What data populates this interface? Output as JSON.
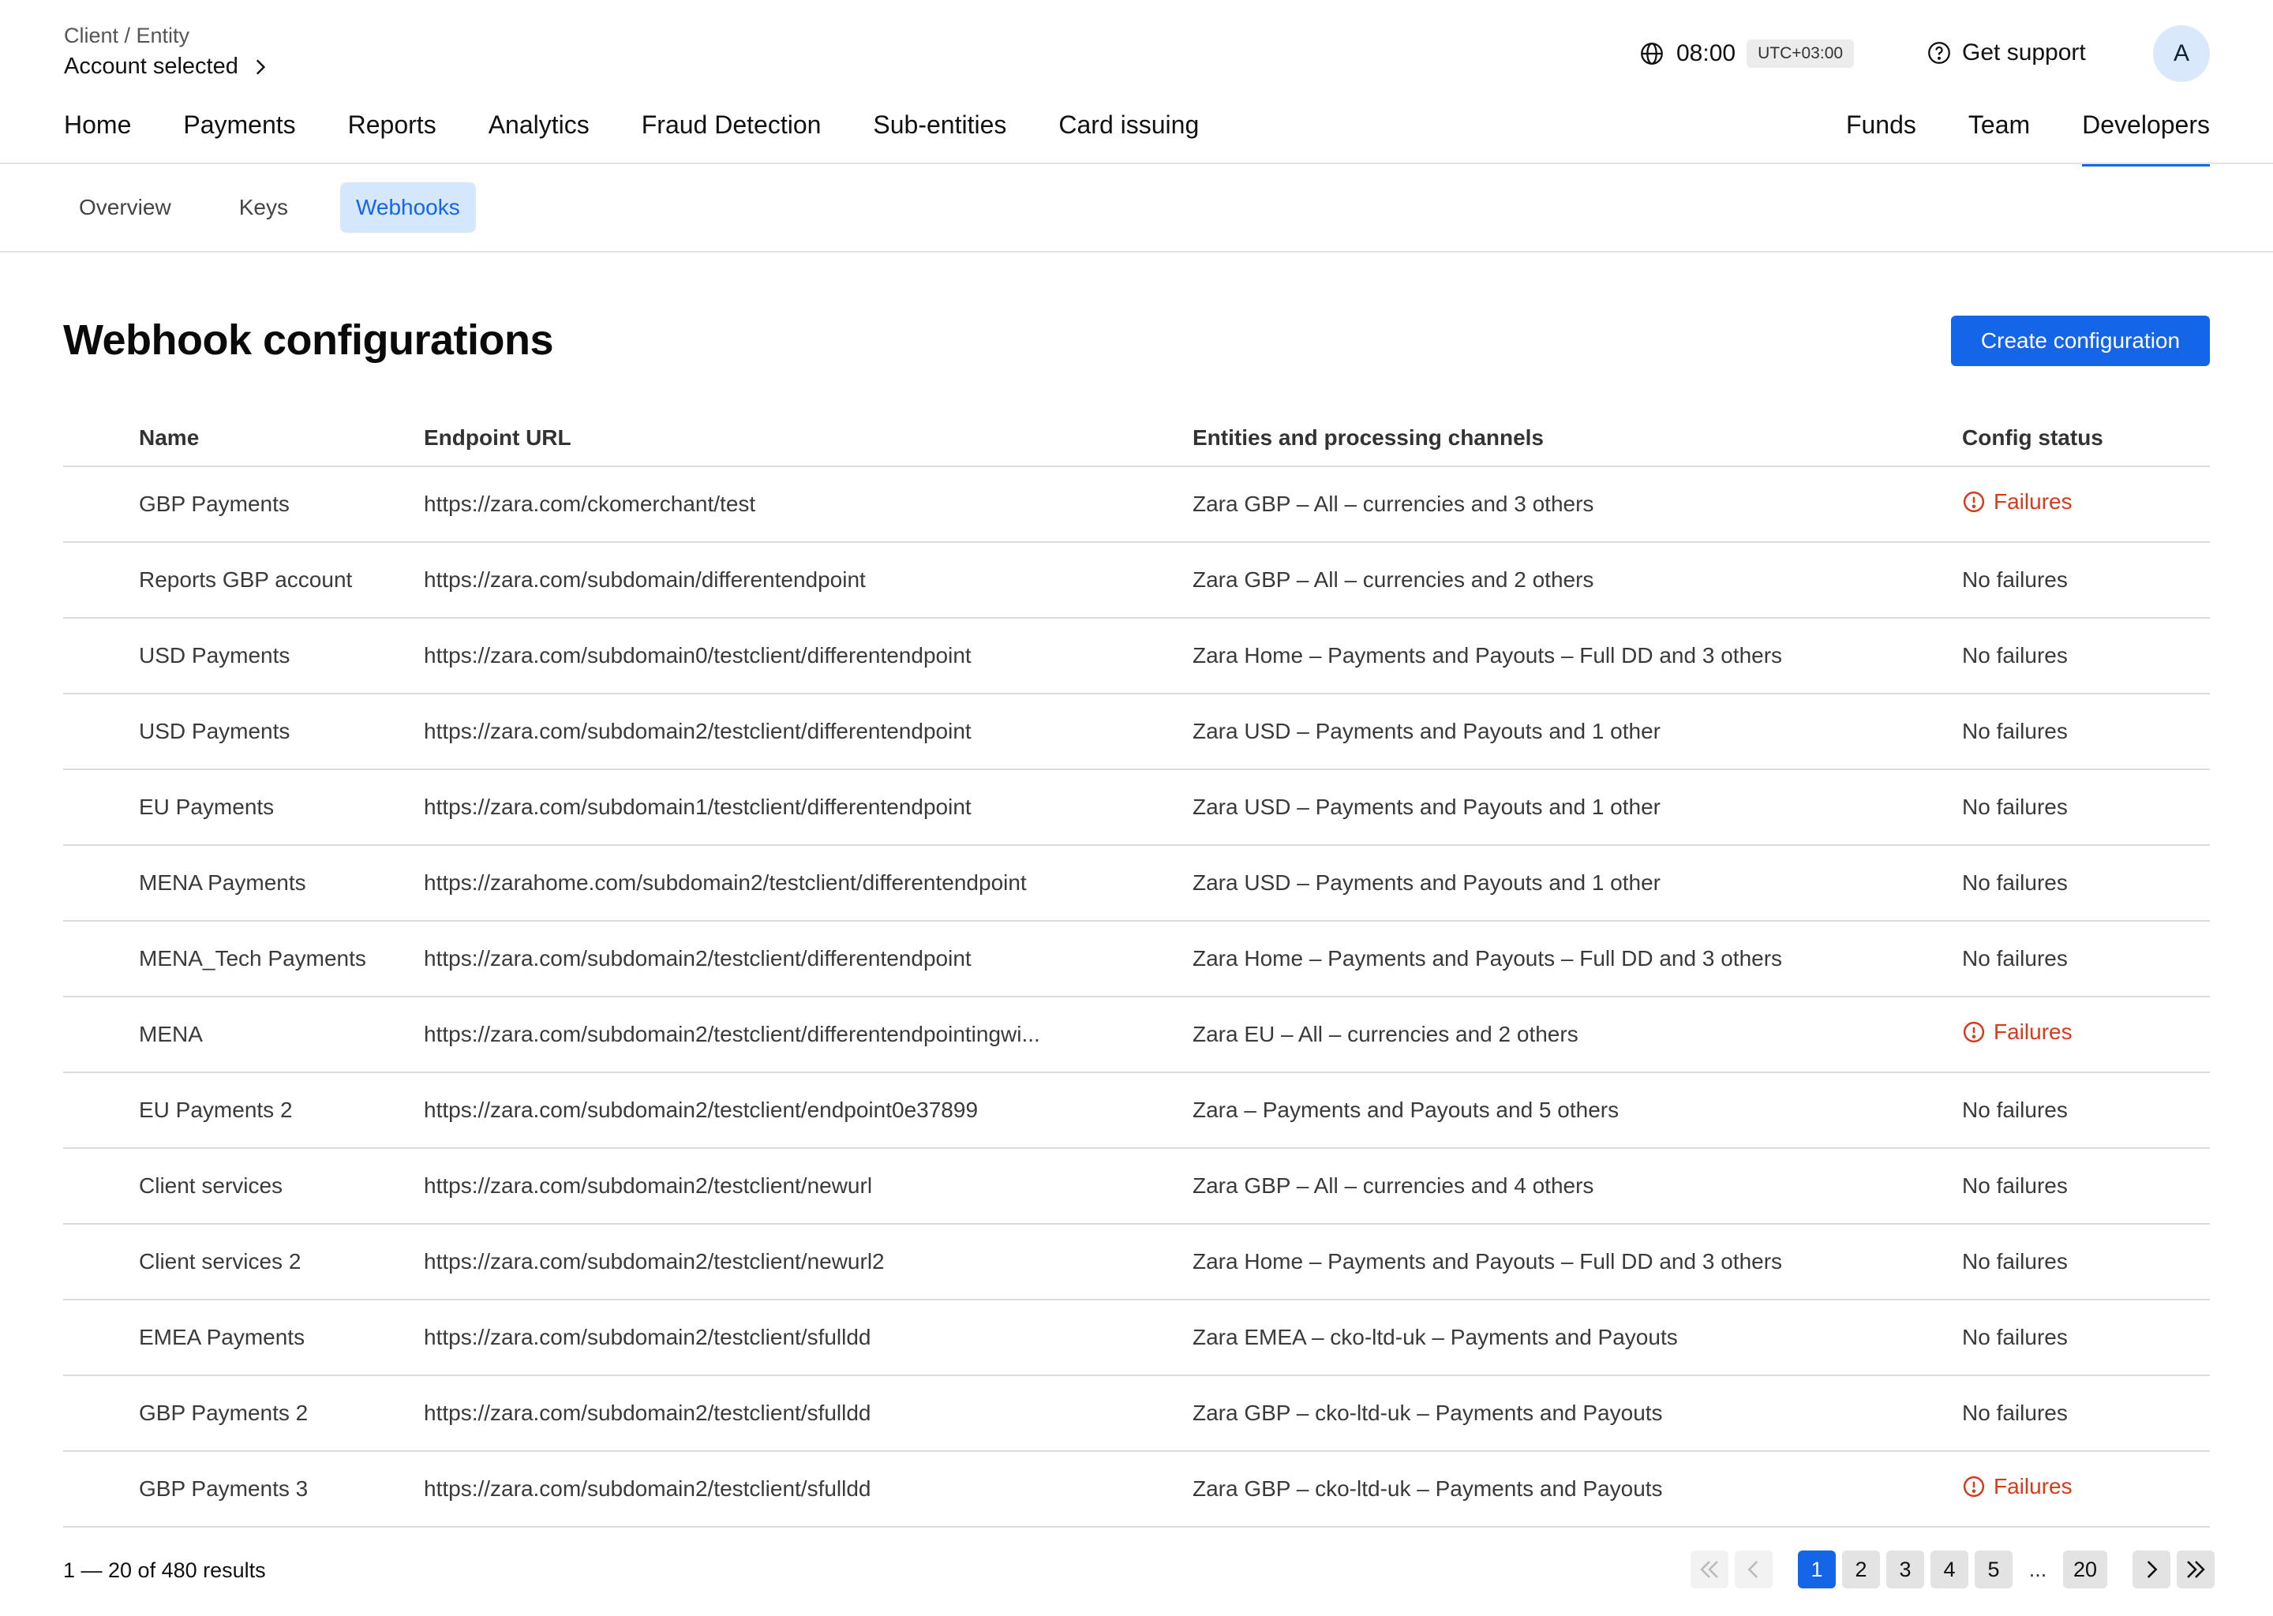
{
  "header": {
    "breadcrumb_top": "Client / Entity",
    "breadcrumb_main": "Account selected",
    "time": "08:00",
    "timezone": "UTC+03:00",
    "support_label": "Get support",
    "avatar_initial": "A"
  },
  "nav": {
    "main": [
      "Home",
      "Payments",
      "Reports",
      "Analytics",
      "Fraud Detection",
      "Sub-entities",
      "Card issuing"
    ],
    "right": [
      "Funds",
      "Team",
      "Developers"
    ],
    "active": "Developers"
  },
  "subnav": {
    "tabs": [
      "Overview",
      "Keys",
      "Webhooks"
    ],
    "active": "Webhooks"
  },
  "page": {
    "title": "Webhook configurations",
    "create_label": "Create configuration"
  },
  "table": {
    "headers": [
      "Name",
      "Endpoint URL",
      "Entities and processing channels",
      "Config status"
    ],
    "rows": [
      {
        "name": "GBP Payments",
        "url": "https://zara.com/ckomerchant/test",
        "entities": "Zara GBP – All – currencies and 3 others",
        "status": "Failures"
      },
      {
        "name": "Reports GBP account",
        "url": "https://zara.com/subdomain/differentendpoint",
        "entities": "Zara GBP – All – currencies and 2 others",
        "status": "No failures"
      },
      {
        "name": "USD Payments",
        "url": "https://zara.com/subdomain0/testclient/differentendpoint",
        "entities": "Zara Home – Payments and Payouts – Full DD and 3 others",
        "status": "No failures"
      },
      {
        "name": "USD Payments",
        "url": "https://zara.com/subdomain2/testclient/differentendpoint",
        "entities": "Zara USD – Payments and Payouts and 1 other",
        "status": "No failures"
      },
      {
        "name": "EU Payments",
        "url": "https://zara.com/subdomain1/testclient/differentendpoint",
        "entities": "Zara USD – Payments and Payouts and 1 other",
        "status": "No failures"
      },
      {
        "name": "MENA Payments",
        "url": "https://zarahome.com/subdomain2/testclient/differentendpoint",
        "entities": "Zara USD – Payments and Payouts and 1 other",
        "status": "No failures"
      },
      {
        "name": "MENA_Tech Payments",
        "url": "https://zara.com/subdomain2/testclient/differentendpoint",
        "entities": "Zara Home – Payments and Payouts – Full DD and 3 others",
        "status": "No failures"
      },
      {
        "name": "MENA",
        "url": "https://zara.com/subdomain2/testclient/differentendpointingwi...",
        "entities": "Zara EU – All – currencies and 2 others",
        "status": "Failures"
      },
      {
        "name": "EU Payments 2",
        "url": "https://zara.com/subdomain2/testclient/endpoint0e37899",
        "entities": "Zara – Payments and Payouts and 5 others",
        "status": "No failures"
      },
      {
        "name": "Client services",
        "url": "https://zara.com/subdomain2/testclient/newurl",
        "entities": "Zara GBP – All – currencies and 4 others",
        "status": "No failures"
      },
      {
        "name": "Client services 2",
        "url": "https://zara.com/subdomain2/testclient/newurl2",
        "entities": "Zara Home – Payments and Payouts – Full DD and 3 others",
        "status": "No failures"
      },
      {
        "name": "EMEA Payments",
        "url": "https://zara.com/subdomain2/testclient/sfulldd",
        "entities": "Zara EMEA – cko-ltd-uk – Payments and Payouts",
        "status": "No failures"
      },
      {
        "name": "GBP Payments 2",
        "url": "https://zara.com/subdomain2/testclient/sfulldd",
        "entities": "Zara GBP – cko-ltd-uk – Payments and Payouts",
        "status": "No failures"
      },
      {
        "name": "GBP Payments 3",
        "url": "https://zara.com/subdomain2/testclient/sfulldd",
        "entities": "Zara GBP – cko-ltd-uk – Payments and Payouts",
        "status": "Failures"
      }
    ]
  },
  "pagination": {
    "summary": "1 — 20 of 480 results",
    "pages": [
      "1",
      "2",
      "3",
      "4",
      "5"
    ],
    "ellipsis": "...",
    "last_page": "20",
    "current": "1"
  },
  "colors": {
    "accent": "#1565e8",
    "failure": "#d83a1a"
  }
}
